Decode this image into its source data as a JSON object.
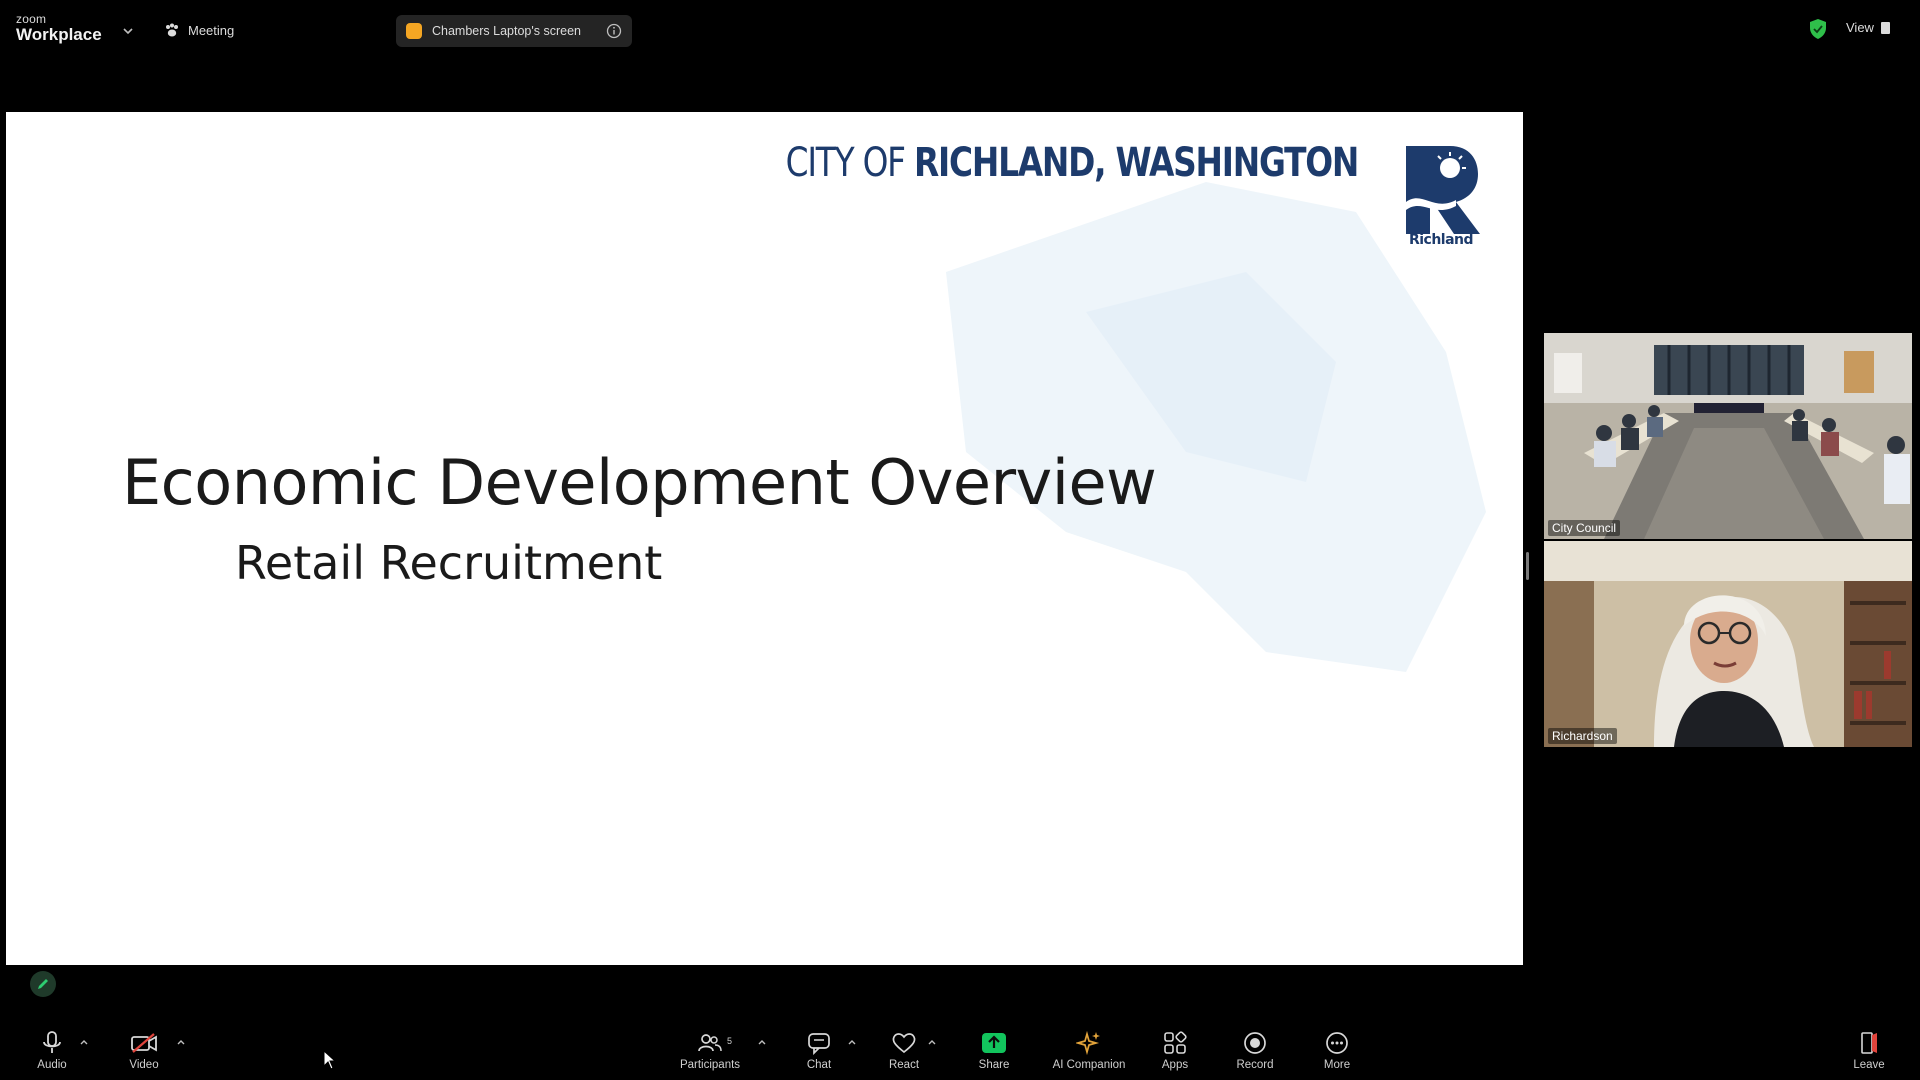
{
  "topbar": {
    "brand_small": "zoom",
    "brand_large": "Workplace",
    "meeting_label": "Meeting",
    "share_label": "Chambers Laptop's screen",
    "view_label": "View"
  },
  "slide": {
    "city_prefix": "CITY OF ",
    "city_name": "RICHLAND, WASHINGTON",
    "logo_text": "Richland",
    "title": "Economic Development Overview",
    "subtitle": "Retail Recruitment"
  },
  "participants_tiles": [
    {
      "name": "City Council"
    },
    {
      "name": "Richardson"
    }
  ],
  "toolbar": {
    "audio": "Audio",
    "video": "Video",
    "participants": "Participants",
    "participants_count": "5",
    "chat": "Chat",
    "react": "React",
    "share": "Share",
    "ai_companion": "AI Companion",
    "apps": "Apps",
    "record": "Record",
    "more": "More",
    "leave": "Leave"
  },
  "colors": {
    "slide_blue": "#1d3b6c",
    "share_green": "#12c45d",
    "ai_gold": "#e2a33a",
    "shield_green": "#2fbf4a",
    "video_off_red": "#e0443c",
    "share_pill_dot": "#f5a623"
  }
}
